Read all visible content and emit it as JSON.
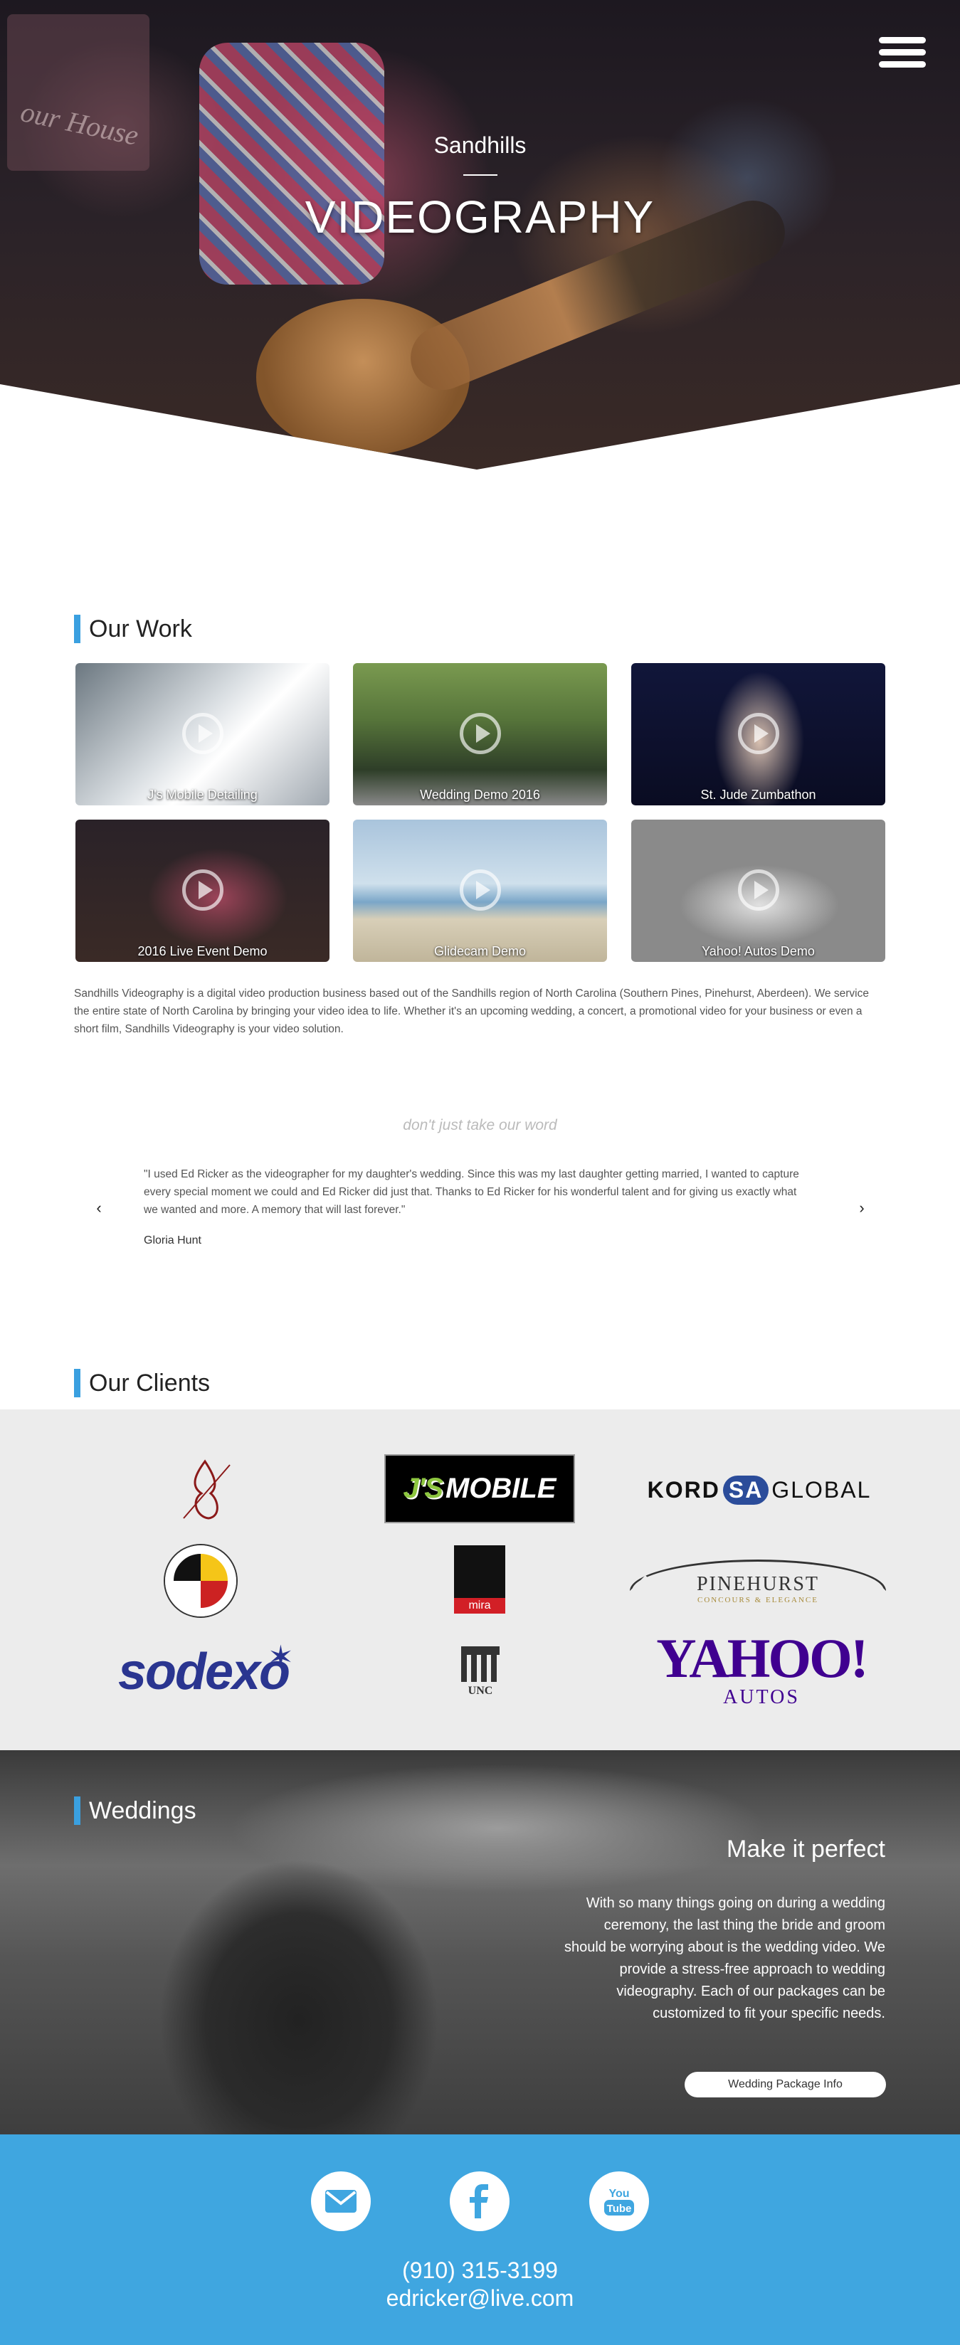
{
  "hero": {
    "subtitle": "Sandhills",
    "title": "VIDEOGRAPHY"
  },
  "our_work": {
    "title": "Our Work",
    "videos": [
      {
        "caption": "J's Mobile Detailing"
      },
      {
        "caption": "Wedding Demo 2016"
      },
      {
        "caption": "St. Jude Zumbathon"
      },
      {
        "caption": "2016 Live Event Demo"
      },
      {
        "caption": "Glidecam Demo"
      },
      {
        "caption": "Yahoo! Autos Demo"
      }
    ],
    "description": "Sandhills Videography is a digital video production business based out of the Sandhills region of North Carolina (Southern Pines, Pinehurst, Aberdeen). We service the entire state of North Carolina by bringing your video idea to life. Whether it's an upcoming wedding, a concert, a promotional video for your business or even a short film, Sandhills Videography is your video solution."
  },
  "testimonials": {
    "tagline": "don't just take our word",
    "quote": "\"I used Ed Ricker as the videographer for my daughter's wedding. Since this was my last daughter getting married, I wanted to capture every special moment we could and Ed Ricker did just that. Thanks to Ed Ricker for his wonderful talent and for giving us exactly what we wanted and more. A memory that will last forever.\"",
    "author": "Gloria Hunt",
    "prev_arrow": "‹",
    "next_arrow": "›"
  },
  "clients": {
    "title": "Our Clients",
    "logos": {
      "js_mobile_a": "J'S",
      "js_mobile_b": "MOBILE",
      "kord_a": "KORD",
      "kord_b": "SA",
      "kord_c": "GLOBAL",
      "mira": "mira",
      "pinehurst": "PINEHURST",
      "pinehurst_sub": "CONCOURS & ELEGANCE",
      "sodexo": "sodexo",
      "unc": "UNC",
      "yahoo": "YAHOO!",
      "yahoo_sub": "AUTOS"
    }
  },
  "weddings": {
    "title": "Weddings",
    "heading": "Make it perfect",
    "body": "With so many things going on during a wedding ceremony, the last thing the bride and groom should be worrying about is the wedding video. We provide a stress-free approach to wedding videography. Each of our packages can be customized to fit your specific needs.",
    "button": "Wedding Package Info"
  },
  "footer": {
    "phone": "(910) 315-3199",
    "email": "edricker@live.com",
    "icons": [
      "envelope-icon",
      "facebook-icon",
      "youtube-icon"
    ]
  },
  "colors": {
    "accent": "#3aa0e0",
    "footer_bg": "#3fa6e0",
    "clients_bg": "#ececec"
  }
}
